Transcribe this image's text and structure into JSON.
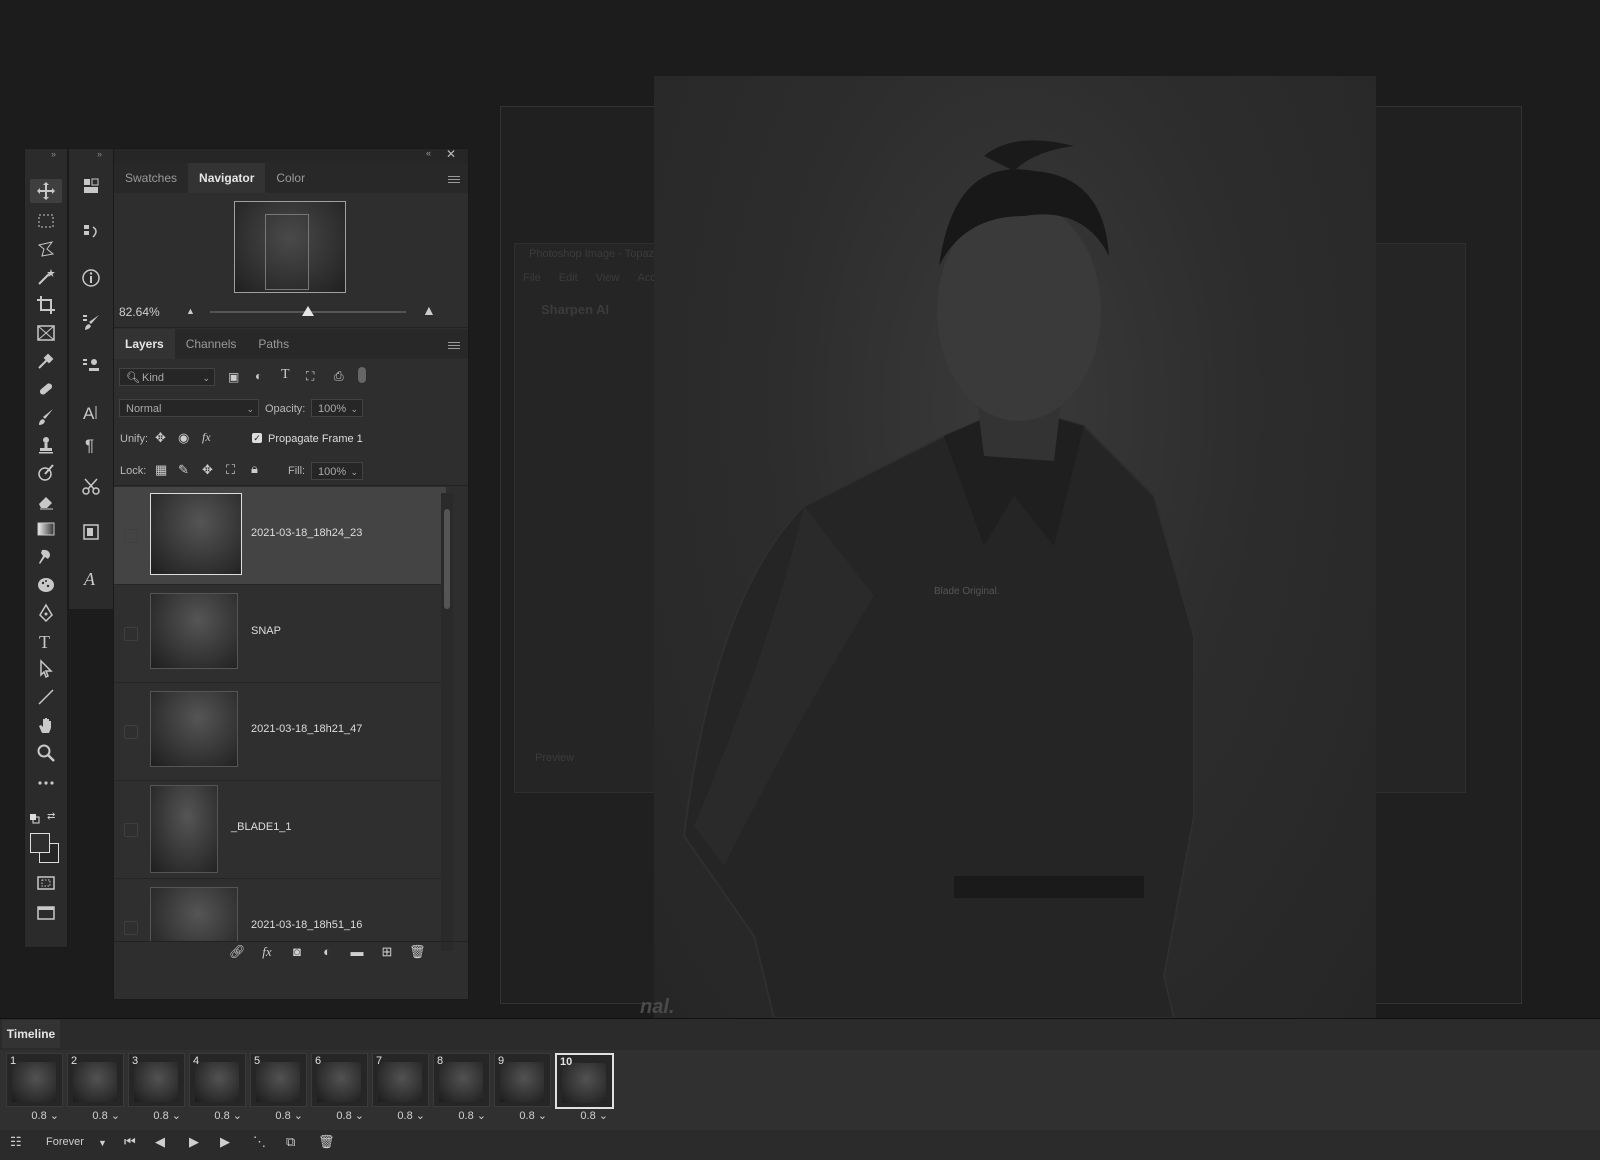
{
  "navigator_panel": {
    "tabs": [
      {
        "label": "Swatches"
      },
      {
        "label": "Navigator"
      },
      {
        "label": "Color"
      }
    ],
    "zoom_value": "82.64%",
    "zoom_slider_level": 0.5
  },
  "layers_panel": {
    "tabs": [
      {
        "label": "Layers"
      },
      {
        "label": "Channels"
      },
      {
        "label": "Paths"
      }
    ],
    "filter_kind": "Kind",
    "blend_mode": "Normal",
    "opacity_label": "Opacity:",
    "opacity_value": "100%",
    "unify_label": "Unify:",
    "propagate_label": "Propagate Frame 1",
    "lock_label": "Lock:",
    "fill_label": "Fill:",
    "fill_value": "100%",
    "layers": [
      {
        "name": "2021-03-18_18h24_23"
      },
      {
        "name": "SNAP"
      },
      {
        "name": "2021-03-18_18h21_47"
      },
      {
        "name": "_BLADE1_1"
      },
      {
        "name": "2021-03-18_18h51_16"
      }
    ]
  },
  "timeline": {
    "title": "Timeline",
    "loop_option": "Forever",
    "frames": [
      {
        "number": "1",
        "delay": "0.8"
      },
      {
        "number": "2",
        "delay": "0.8"
      },
      {
        "number": "3",
        "delay": "0.8"
      },
      {
        "number": "4",
        "delay": "0.8"
      },
      {
        "number": "5",
        "delay": "0.8"
      },
      {
        "number": "6",
        "delay": "0.8"
      },
      {
        "number": "7",
        "delay": "0.8"
      },
      {
        "number": "8",
        "delay": "0.8"
      },
      {
        "number": "9",
        "delay": "0.8"
      },
      {
        "number": "10",
        "delay": "0.8"
      }
    ]
  },
  "background_window": {
    "title": "Photoshop Image - Topaz",
    "menu": [
      "File",
      "Edit",
      "View",
      "Accou"
    ],
    "app_name": "Sharpen AI",
    "preview_label": "Preview"
  },
  "artwork": {
    "badge_text": "Blade Original.",
    "corner_text": "nal."
  },
  "icons": {
    "tools": [
      "move-icon",
      "marquee-icon",
      "lasso-icon",
      "magic-wand-icon",
      "crop-icon",
      "frame-icon",
      "eyedropper-icon",
      "healing-icon",
      "brush-icon",
      "stamp-icon",
      "history-brush-icon",
      "eraser-icon",
      "gradient-icon",
      "smudge-icon",
      "sponge-icon",
      "pen-icon",
      "type-icon",
      "path-select-icon",
      "line-icon",
      "hand-icon",
      "zoom-icon",
      "more-icon"
    ]
  }
}
